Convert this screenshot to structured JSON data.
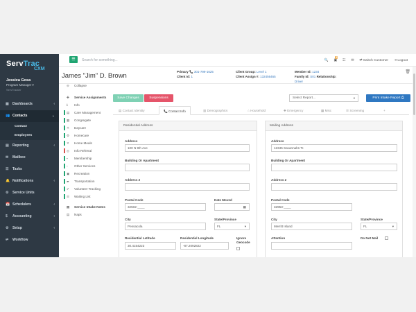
{
  "sidebar": {
    "logo_main": "Serv",
    "logo_accent": "Trac",
    "logo_sub": "CXM",
    "user_name": "Jessica Gosa",
    "user_role": "Program Manager ▾",
    "user_org": "ServTracker",
    "items": [
      {
        "label": "Dashboards",
        "icon": "▦",
        "chevron": "‹"
      },
      {
        "label": "Contacts",
        "icon": "👥",
        "chevron": "⌄"
      },
      {
        "label": "Contact",
        "sub": true
      },
      {
        "label": "Employees",
        "sub": true
      },
      {
        "label": "Reporting",
        "icon": "▤",
        "chevron": "‹"
      },
      {
        "label": "Mailbox",
        "icon": "✉",
        "chevron": ""
      },
      {
        "label": "Tasks",
        "icon": "☰",
        "chevron": ""
      },
      {
        "label": "Notifications",
        "icon": "🔔",
        "chevron": "‹"
      },
      {
        "label": "Service Units",
        "icon": "⚙",
        "chevron": ""
      },
      {
        "label": "Schedulers",
        "icon": "📅",
        "chevron": "‹"
      },
      {
        "label": "Accounting",
        "icon": "$",
        "chevron": "‹"
      },
      {
        "label": "Setup",
        "icon": "⚙",
        "chevron": "‹"
      },
      {
        "label": "Workflow",
        "icon": "⇄",
        "chevron": ""
      }
    ]
  },
  "topbar": {
    "menu_icon": "☰",
    "search_placeholder": "Search for something...",
    "notif_count": "5",
    "switch_customer": "Switch Customer",
    "logout": "Logout"
  },
  "header": {
    "person_name": "James \"Jim\" D. Brown",
    "primary_label": "Primary",
    "primary_value": "301-799-1625",
    "client_id_label": "Client Id:",
    "client_id_value": "1",
    "client_group_label": "Client Group:",
    "client_group_value": "Level 1",
    "client_assign_label": "Client Assign #:",
    "client_assign_value": "132456465",
    "member_id_label": "Member Id:",
    "member_id_value": "1234",
    "family_id_label": "Family Id:",
    "family_id_value": "S01",
    "relationship_label": "Relationship:",
    "relationship_value": "Driver"
  },
  "submenu": {
    "collapse": "Collapse",
    "service_assignments": "Service Assignments",
    "info": "Info",
    "items": [
      {
        "label": "Care Management",
        "bar": "green"
      },
      {
        "label": "Congregate",
        "bar": "green"
      },
      {
        "label": "Daycare",
        "bar": "green"
      },
      {
        "label": "Homecare",
        "bar": "green"
      },
      {
        "label": "Home Meals",
        "bar": "green"
      },
      {
        "label": "Info Referral",
        "bar": "red"
      },
      {
        "label": "Membership",
        "bar": "green"
      },
      {
        "label": "Other Services",
        "bar": "green"
      },
      {
        "label": "Recreation",
        "bar": "green"
      },
      {
        "label": "Transportation",
        "bar": "green"
      },
      {
        "label": "Volunteer Tracking",
        "bar": "green"
      },
      {
        "label": "Waiting List",
        "bar": "green"
      }
    ],
    "service_intake_notes": "Service Intake Notes",
    "naps": "Naps"
  },
  "actions": {
    "save": "Save Changes",
    "suspensions": "Suspensions",
    "report_placeholder": "Select Report...",
    "print_intake": "Print Intake Report"
  },
  "tabs": [
    {
      "label": "Contact Identity"
    },
    {
      "label": "Contact Info",
      "active": true
    },
    {
      "label": "Demographics"
    },
    {
      "label": "Household"
    },
    {
      "label": "Emergency"
    },
    {
      "label": "Misc"
    },
    {
      "label": "Screening"
    },
    {
      "label": "+"
    }
  ],
  "residential": {
    "title": "Residential Address",
    "address_label": "Address",
    "address_value": "100 N 9th Ave",
    "building_label": "Building Or Apartment",
    "building_value": "",
    "address2_label": "Address 2",
    "address2_value": "",
    "postal_label": "Postal Code",
    "postal_value": "32502-____",
    "date_moved_label": "Date Moved",
    "date_moved_value": "",
    "city_label": "City",
    "city_value": "Pensacola",
    "state_label": "State/Province",
    "state_value": "FL",
    "lat_label": "Residential Latitude",
    "lat_value": "30.4154223",
    "lon_label": "Residential Longitude",
    "lon_value": "-87.2092822",
    "ignore_label": "Ignore Geocode"
  },
  "mailing": {
    "title": "Mailing Address",
    "address_label": "Address",
    "address_value": "12345 Savannahs Tr.",
    "building_label": "Building Or Apartment",
    "building_value": "",
    "address2_label": "Address 2",
    "address2_value": "",
    "postal_label": "Postal Code",
    "postal_value": "32953-____",
    "city_label": "City",
    "city_value": "Merritt Island",
    "state_label": "State/Province",
    "state_value": "FL",
    "attention_label": "Attention",
    "attention_value": "",
    "do_not_mail_label": "Do Not Mail"
  }
}
